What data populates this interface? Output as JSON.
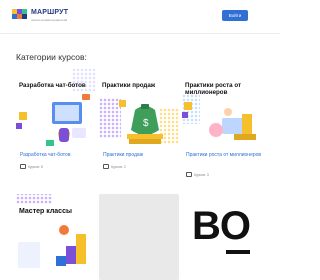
{
  "header": {
    "logo_text": "МАРШРУТ",
    "logo_sub": "школа онлайн-профессий",
    "login_label": "Войти"
  },
  "section_title": "Категории курсов:",
  "courses": [
    {
      "image_title": "Разработка чат-ботов",
      "name": "Разработка чат-ботов",
      "meta": "Курсов: 8"
    },
    {
      "image_title": "Практики продаж",
      "name": "Практики продаж",
      "meta": "Курсов: 2"
    },
    {
      "image_title": "Практики роста от миллионеров",
      "name": "Практики роста от миллионеров",
      "meta": "Курсов: 3"
    },
    {
      "image_title": "Мастер классы"
    },
    {
      "image_title": ""
    },
    {
      "image_title": "BO"
    }
  ],
  "colors": {
    "brand": "#233a82",
    "accent": "#2f6fd6",
    "yellow": "#f5c02b",
    "purple": "#7b4fd8",
    "green": "#34c48b"
  }
}
